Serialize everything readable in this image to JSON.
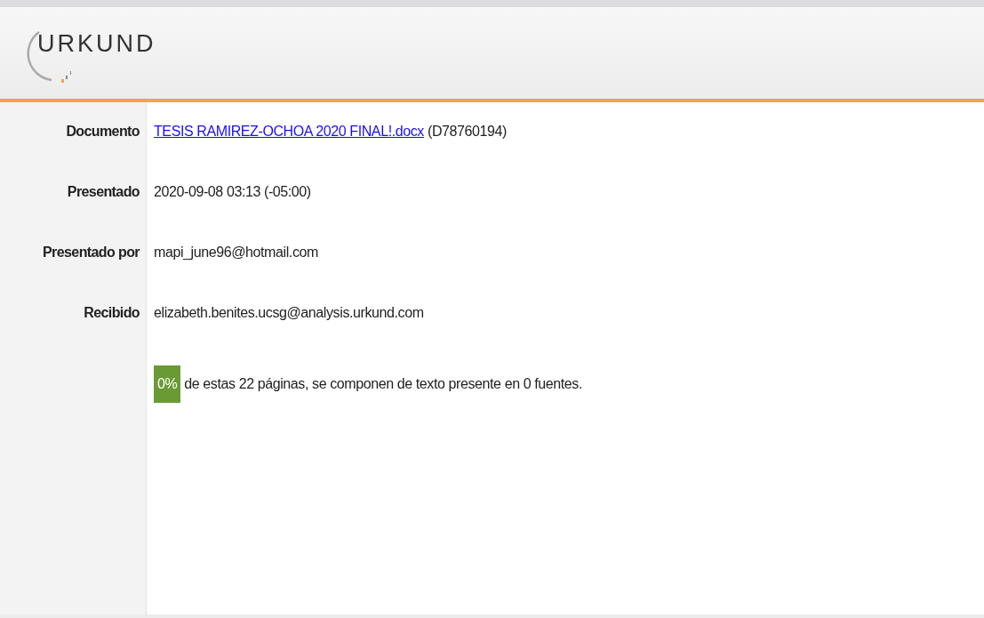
{
  "header": {
    "logo": "URKUND"
  },
  "fields": [
    {
      "label": "Documento",
      "kind": "link",
      "link": "TESIS RAMIREZ-OCHOA 2020 FINAL!.docx",
      "value": "(D78760194)"
    },
    {
      "label": "Presentado",
      "kind": "text",
      "value": "2020-09-08 03:13 (-05:00)"
    },
    {
      "label": "Presentado por",
      "kind": "text",
      "value": "mapi_june96@hotmail.com"
    },
    {
      "label": "Recibido",
      "kind": "text",
      "value": "elizabeth.benites.ucsg@analysis.urkund.com"
    }
  ],
  "summary": {
    "percent": "0%",
    "text": "de estas 22 páginas, se componen de texto presente en 0 fuentes."
  }
}
